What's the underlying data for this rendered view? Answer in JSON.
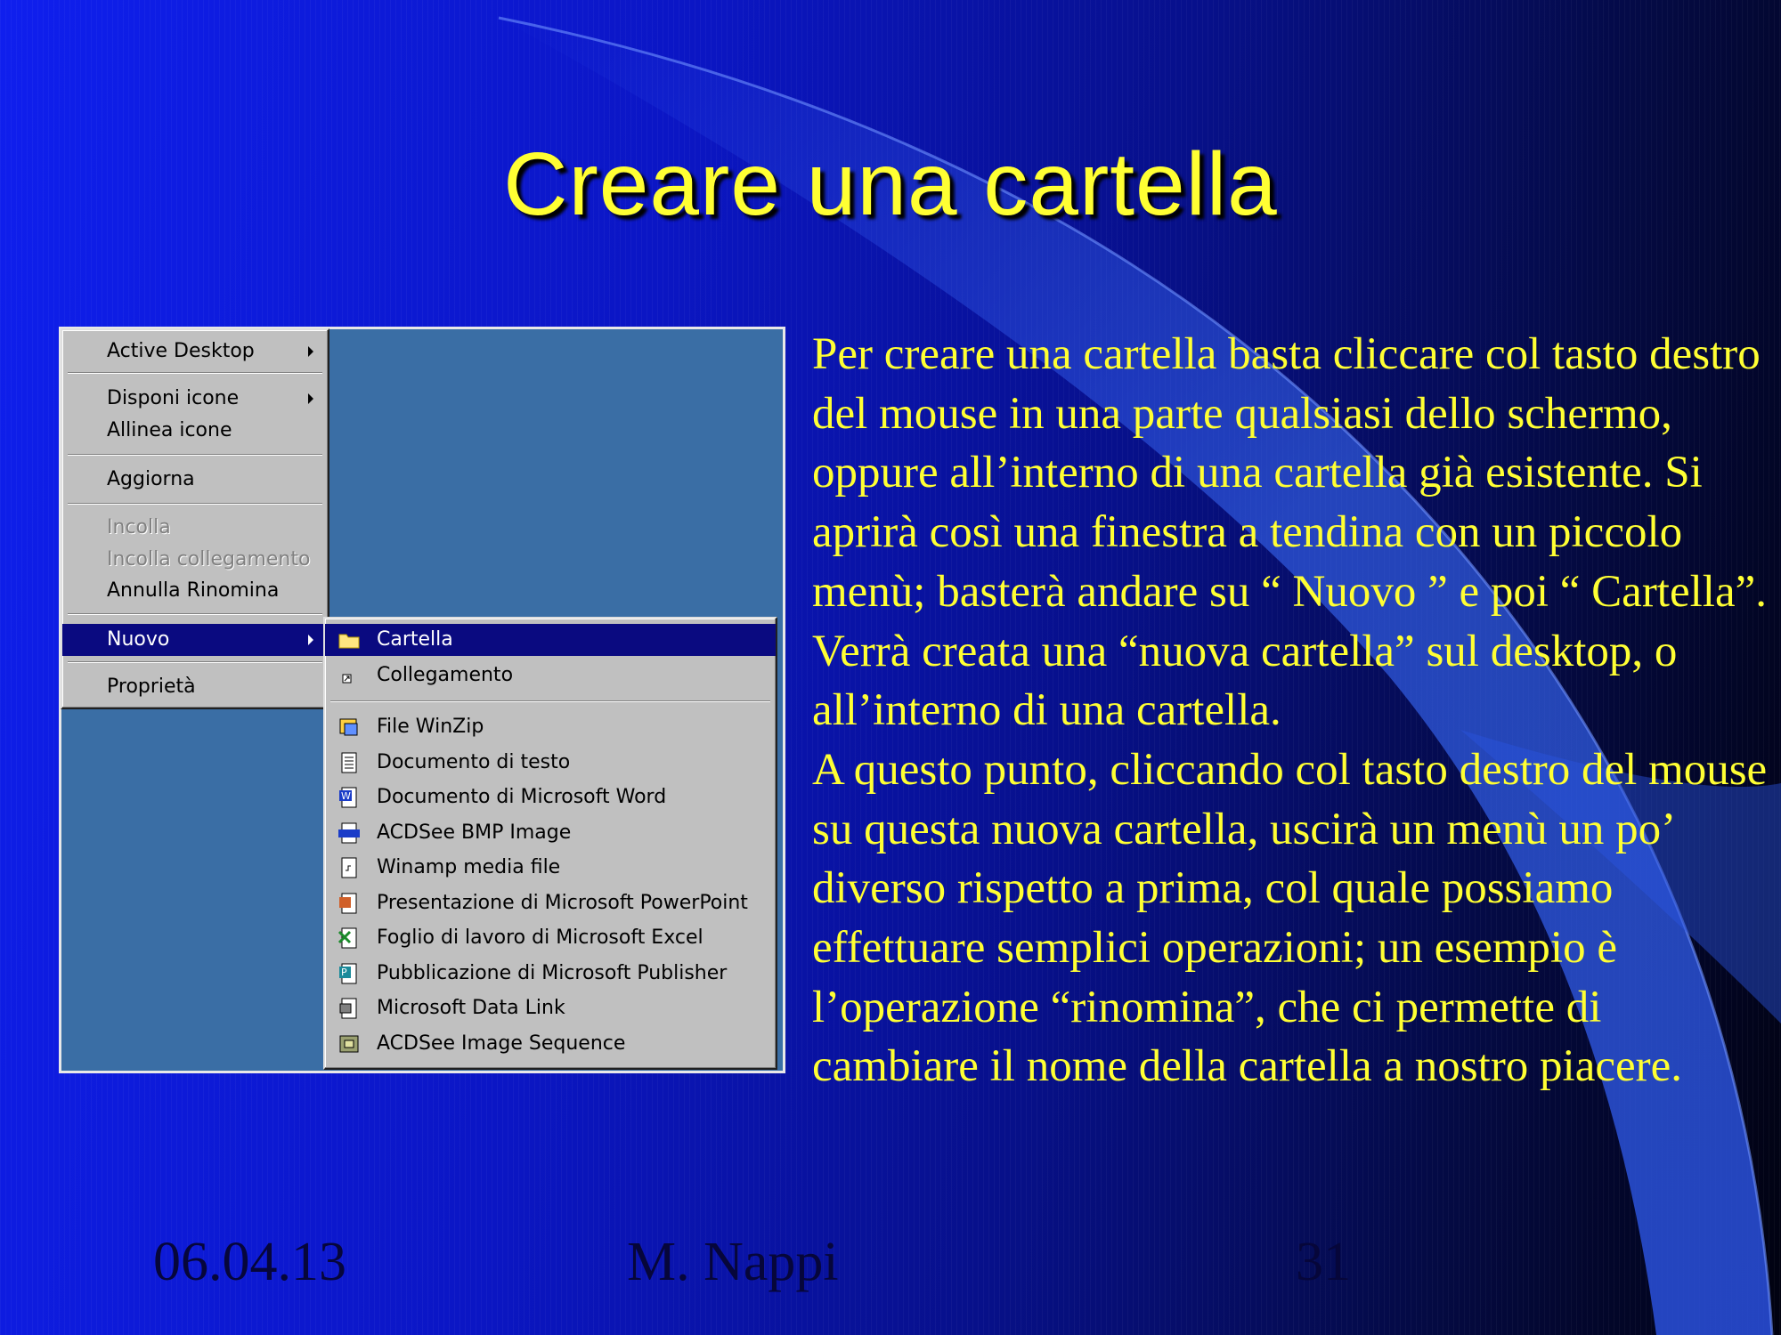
{
  "slide": {
    "title": "Creare una cartella",
    "paragraph1": "Per creare una cartella basta cliccare col tasto destro del mouse in una parte qualsiasi dello schermo, oppure all’interno di una cartella già esistente. Si aprirà così una finestra a tendina con un piccolo menù; basterà andare su “ Nuovo ” e poi “ Cartella”. Verrà creata una “nuova cartella” sul desktop, o all’interno di una cartella.",
    "paragraph2": "A questo punto, cliccando col tasto destro del mouse su questa nuova cartella, uscirà un menù un po’ diverso rispetto a prima, col quale possiamo effettuare semplici operazioni; un esempio è l’operazione “rinomina”, che ci permette di cambiare il nome della cartella a nostro piacere.",
    "footer_date": "06.04.13",
    "footer_author": "M. Nappi",
    "footer_page": "31"
  },
  "context_menu": {
    "items": [
      {
        "label": "Active Desktop",
        "submenu": true,
        "enabled": true
      },
      {
        "label": "Disponi icone",
        "submenu": true,
        "enabled": true
      },
      {
        "label": "Allinea icone",
        "submenu": false,
        "enabled": true
      },
      {
        "label": "Aggiorna",
        "submenu": false,
        "enabled": true
      },
      {
        "label": "Incolla",
        "submenu": false,
        "enabled": false
      },
      {
        "label": "Incolla collegamento",
        "submenu": false,
        "enabled": false
      },
      {
        "label": "Annulla Rinomina",
        "submenu": false,
        "enabled": true
      },
      {
        "label": "Nuovo",
        "submenu": true,
        "enabled": true,
        "selected": true
      },
      {
        "label": "Proprietà",
        "submenu": false,
        "enabled": true
      }
    ]
  },
  "new_submenu": {
    "items": [
      {
        "label": "Cartella",
        "icon": "folder-icon",
        "selected": true
      },
      {
        "label": "Collegamento",
        "icon": "shortcut-icon"
      },
      {
        "label": "File WinZip",
        "icon": "winzip-icon"
      },
      {
        "label": "Documento di testo",
        "icon": "text-document-icon"
      },
      {
        "label": "Documento di Microsoft Word",
        "icon": "word-document-icon"
      },
      {
        "label": "ACDSee BMP Image",
        "icon": "bmp-image-icon"
      },
      {
        "label": "Winamp media file",
        "icon": "winamp-file-icon"
      },
      {
        "label": "Presentazione di Microsoft PowerPoint",
        "icon": "powerpoint-icon"
      },
      {
        "label": "Foglio di lavoro di Microsoft Excel",
        "icon": "excel-icon"
      },
      {
        "label": "Pubblicazione di Microsoft Publisher",
        "icon": "publisher-icon"
      },
      {
        "label": "Microsoft Data Link",
        "icon": "data-link-icon"
      },
      {
        "label": "ACDSee Image Sequence",
        "icon": "image-sequence-icon"
      }
    ]
  },
  "colors": {
    "title": "#ffff33",
    "menu_background": "#c0c0c0",
    "menu_selection": "#0a0a80",
    "desktop": "#3a6ea5"
  }
}
